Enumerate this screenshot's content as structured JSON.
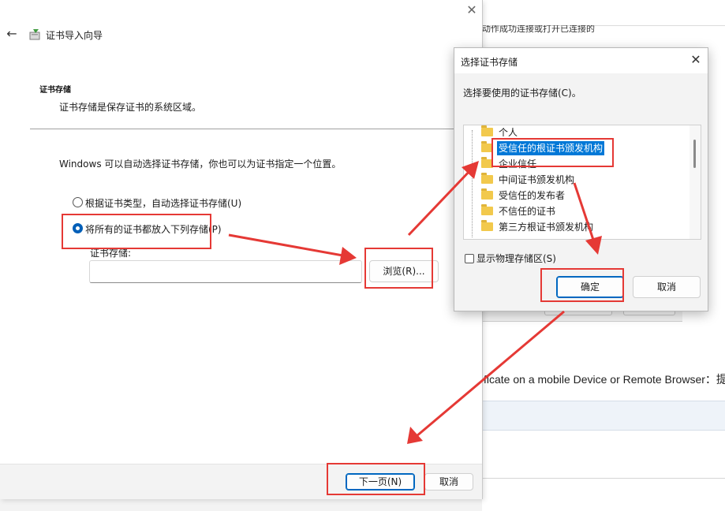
{
  "background_page": {
    "partial_text_top": "动作成功连接或打开已连接的",
    "partial_text_mid": "ficate on a mobile Device or Remote Browser：提"
  },
  "wizard": {
    "title": "证书导入向导",
    "section_title": "证书存储",
    "section_desc": "证书存储是保存证书的系统区域。",
    "intro": "Windows 可以自动选择证书存储，你也可以为证书指定一个位置。",
    "radio_auto": "根据证书类型，自动选择证书存储(U)",
    "radio_manual": "将所有的证书都放入下列存储(P)",
    "store_label": "证书存储:",
    "store_value": "",
    "browse_button": "浏览(R)...",
    "next_button": "下一页(N)",
    "cancel_button": "取消"
  },
  "dialog": {
    "title": "选择证书存储",
    "prompt": "选择要使用的证书存储(C)。",
    "stores": [
      "个人",
      "受信任的根证书颁发机构",
      "企业信任",
      "中间证书颁发机构",
      "受信任的发布者",
      "不信任的证书",
      "第三方根证书颁发机构"
    ],
    "selected_store": "受信任的根证书颁发机构",
    "show_physical": "显示物理存储区(S)",
    "ok_button": "确定",
    "cancel_button": "取消"
  },
  "colors": {
    "annotation": "#e53935",
    "selection": "#0078d7",
    "primary_border": "#0067c0"
  }
}
